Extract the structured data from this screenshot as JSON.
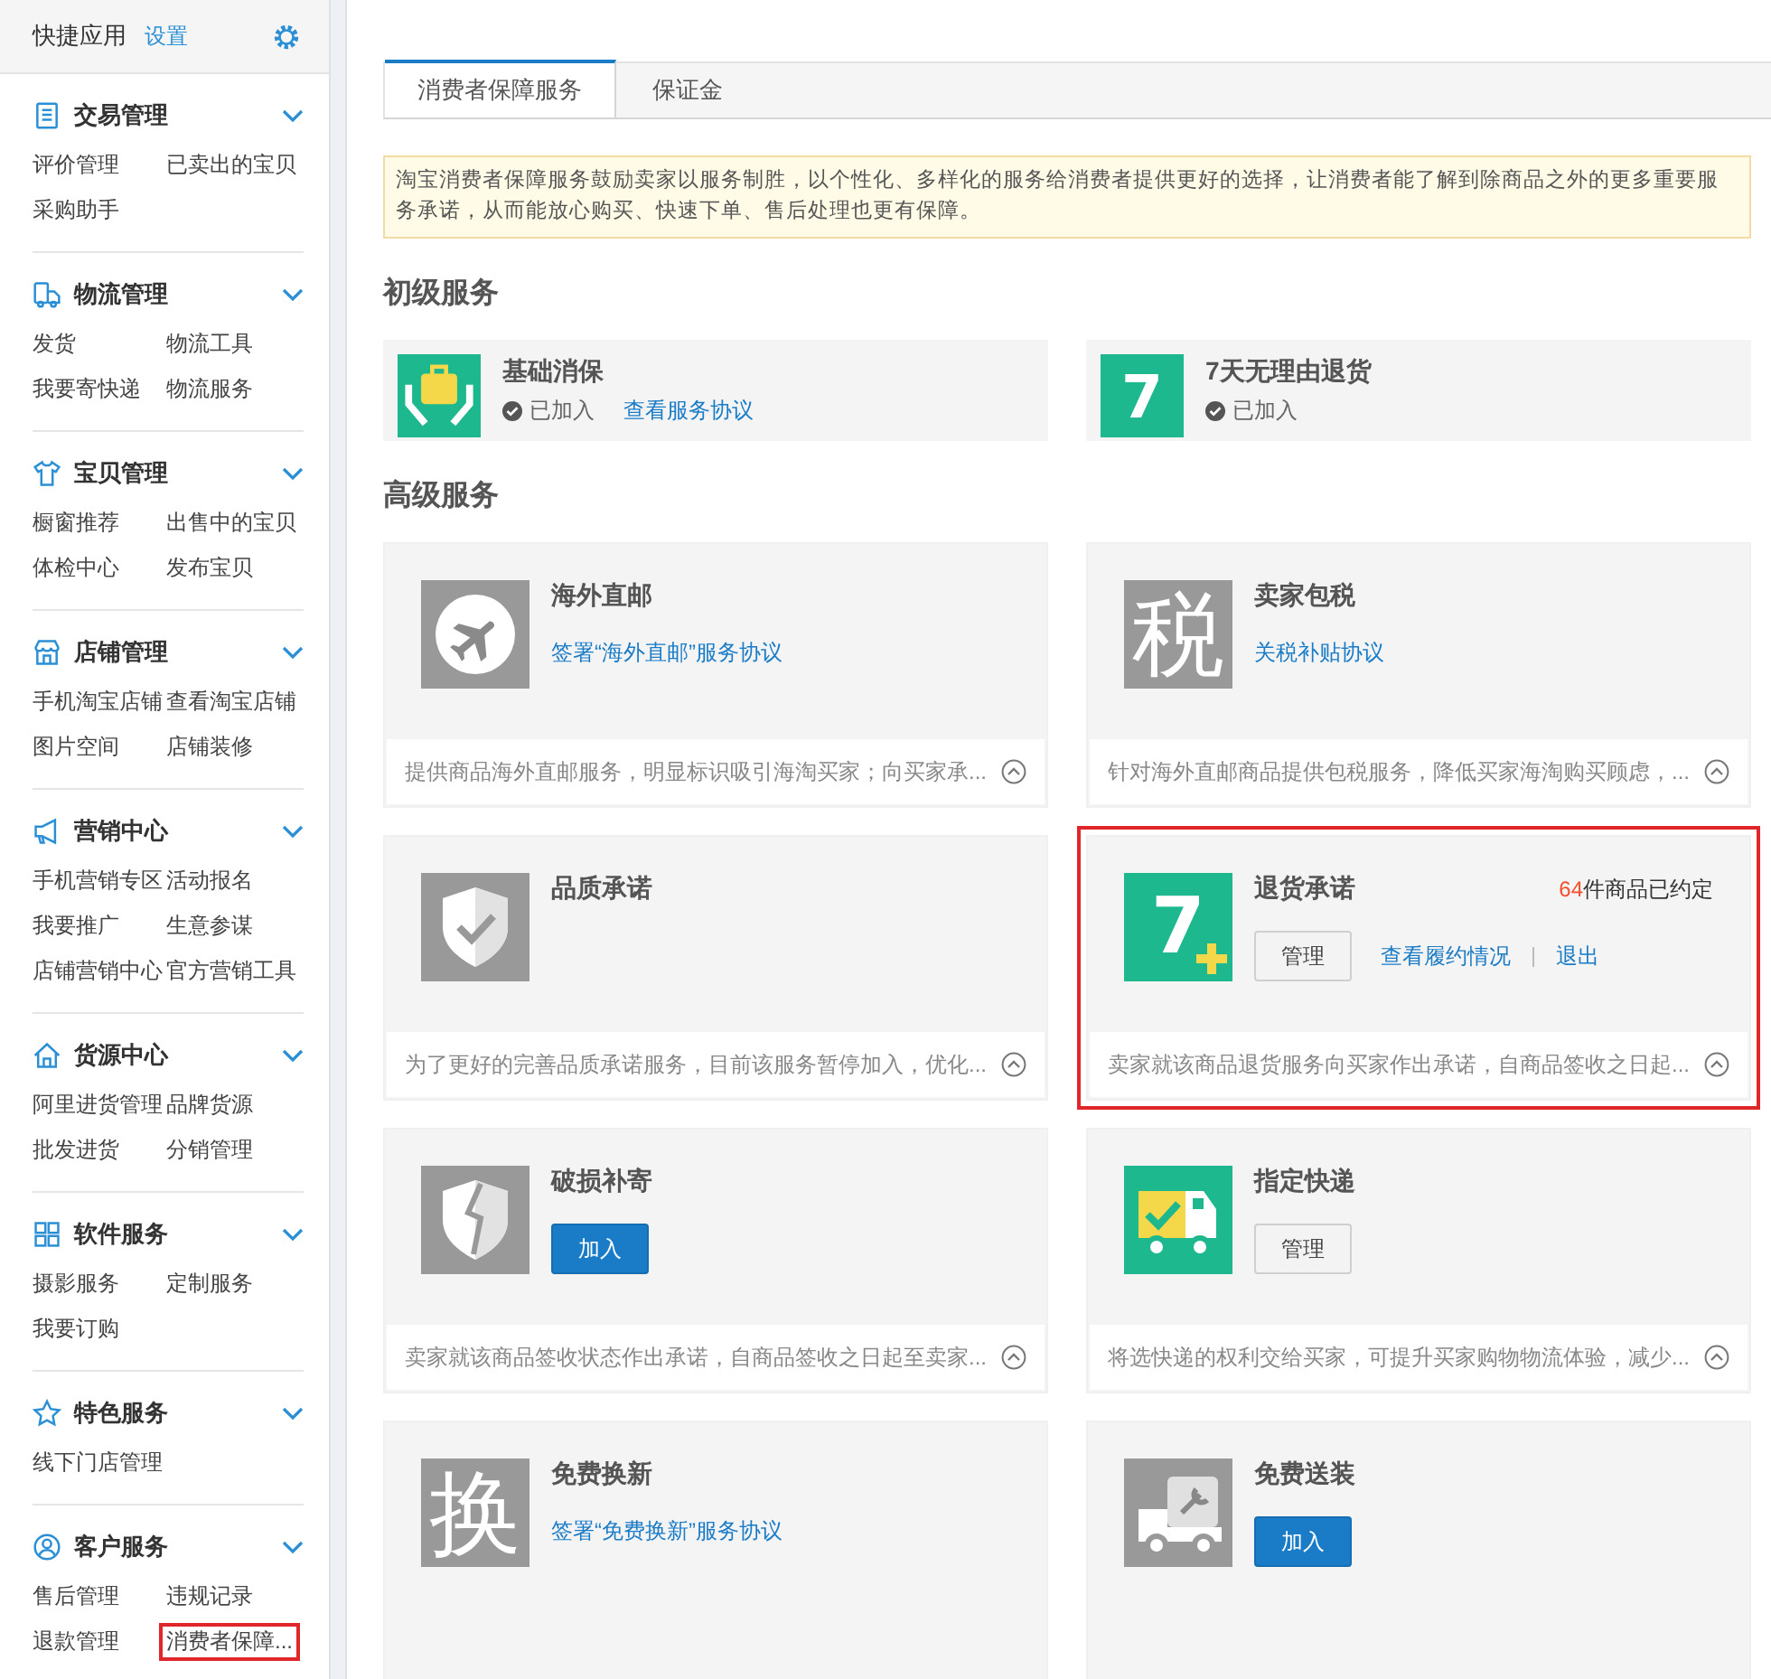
{
  "sidebar": {
    "title": "快捷应用",
    "settings_link": "设置",
    "groups": [
      {
        "kind": "list",
        "title": "交易管理",
        "expanded": true,
        "items": [
          {
            "label": "评价管理",
            "highlighted": false
          },
          {
            "label": "已卖出的宝贝",
            "highlighted": false
          },
          {
            "label": "采购助手",
            "highlighted": false
          }
        ]
      },
      {
        "kind": "truck",
        "title": "物流管理",
        "expanded": true,
        "items": [
          {
            "label": "发货",
            "highlighted": false
          },
          {
            "label": "物流工具",
            "highlighted": false
          },
          {
            "label": "我要寄快递",
            "highlighted": false
          },
          {
            "label": "物流服务",
            "highlighted": false
          }
        ]
      },
      {
        "kind": "shirt",
        "title": "宝贝管理",
        "expanded": true,
        "items": [
          {
            "label": "橱窗推荐",
            "highlighted": false
          },
          {
            "label": "出售中的宝贝",
            "highlighted": false
          },
          {
            "label": "体检中心",
            "highlighted": false
          },
          {
            "label": "发布宝贝",
            "highlighted": false
          }
        ]
      },
      {
        "kind": "shop",
        "title": "店铺管理",
        "expanded": true,
        "items": [
          {
            "label": "手机淘宝店铺",
            "highlighted": false
          },
          {
            "label": "查看淘宝店铺",
            "highlighted": false
          },
          {
            "label": "图片空间",
            "highlighted": false
          },
          {
            "label": "店铺装修",
            "highlighted": false
          }
        ]
      },
      {
        "kind": "megaphone",
        "title": "营销中心",
        "expanded": true,
        "items": [
          {
            "label": "手机营销专区",
            "highlighted": false
          },
          {
            "label": "活动报名",
            "highlighted": false
          },
          {
            "label": "我要推广",
            "highlighted": false
          },
          {
            "label": "生意参谋",
            "highlighted": false
          },
          {
            "label": "店铺营销中心",
            "highlighted": false
          },
          {
            "label": "官方营销工具",
            "highlighted": false
          }
        ]
      },
      {
        "kind": "house",
        "title": "货源中心",
        "expanded": true,
        "items": [
          {
            "label": "阿里进货管理",
            "highlighted": false
          },
          {
            "label": "品牌货源",
            "highlighted": false
          },
          {
            "label": "批发进货",
            "highlighted": false
          },
          {
            "label": "分销管理",
            "highlighted": false
          }
        ]
      },
      {
        "kind": "grid",
        "title": "软件服务",
        "expanded": true,
        "items": [
          {
            "label": "摄影服务",
            "highlighted": false
          },
          {
            "label": "定制服务",
            "highlighted": false
          },
          {
            "label": "我要订购",
            "highlighted": false
          }
        ]
      },
      {
        "kind": "star",
        "title": "特色服务",
        "expanded": true,
        "items": [
          {
            "label": "线下门店管理",
            "highlighted": false
          }
        ]
      },
      {
        "kind": "user",
        "title": "客户服务",
        "expanded": true,
        "items": [
          {
            "label": "售后管理",
            "highlighted": false
          },
          {
            "label": "违规记录",
            "highlighted": false
          },
          {
            "label": "退款管理",
            "highlighted": false
          },
          {
            "label": "消费者保障...",
            "highlighted": true
          }
        ]
      }
    ]
  },
  "tabs": [
    {
      "label": "消费者保障服务",
      "selected": true
    },
    {
      "label": "保证金",
      "selected": false
    }
  ],
  "notice": "淘宝消费者保障服务鼓励卖家以服务制胜，以个性化、多样化的服务给消费者提供更好的选择，让消费者能了解到除商品之外的更多重要服务承诺，从而能放心购买、快速下单、售后处理也更有保障。",
  "basic_services": {
    "heading": "初级服务",
    "items": [
      {
        "kind": "bag",
        "color": "#1eb88f",
        "name": "基础消保",
        "actions": [
          {
            "kind": "status",
            "label": "已加入"
          },
          {
            "kind": "link",
            "label": "查看服务协议"
          }
        ]
      },
      {
        "kind": "seven",
        "icon_text": "7",
        "color": "#1eb88f",
        "name": "7天无理由退货",
        "actions": [
          {
            "kind": "status",
            "label": "已加入"
          }
        ]
      }
    ]
  },
  "advanced_services": {
    "heading": "高级服务",
    "items": [
      {
        "kind": "plane",
        "color": "#999999",
        "name": "海外直邮",
        "highlighted": false,
        "actions": [
          {
            "kind": "link",
            "label": "签署“海外直邮”服务协议"
          }
        ],
        "description": "提供商品海外直邮服务，明显标识吸引海淘买家；向买家承..."
      },
      {
        "kind": "char",
        "icon_text": "税",
        "color": "#999999",
        "name": "卖家包税",
        "highlighted": false,
        "actions": [
          {
            "kind": "link",
            "label": "关税补贴协议"
          }
        ],
        "description": "针对海外直邮商品提供包税服务，降低买家海淘购买顾虑，..."
      },
      {
        "kind": "shield-check",
        "color": "#999999",
        "name": "品质承诺",
        "highlighted": false,
        "description": "为了更好的完善品质承诺服务，目前该服务暂停加入，优化..."
      },
      {
        "kind": "seven-plus",
        "icon_text": "7",
        "color": "#1eb88f",
        "name": "退货承诺",
        "highlighted": true,
        "count": "64",
        "count_suffix": "件商品已约定",
        "actions": [
          {
            "kind": "button",
            "label": "管理"
          },
          {
            "kind": "link",
            "label": "查看履约情况"
          },
          {
            "kind": "link",
            "label": "退出"
          }
        ],
        "description": "卖家就该商品退货服务向买家作出承诺，自商品签收之日起..."
      },
      {
        "kind": "shield-crack",
        "color": "#999999",
        "name": "破损补寄",
        "highlighted": false,
        "actions": [
          {
            "kind": "primary",
            "label": "加入"
          }
        ],
        "description": "卖家就该商品签收状态作出承诺，自商品签收之日起至卖家..."
      },
      {
        "kind": "truck-check",
        "color": "#1eb88f",
        "name": "指定快递",
        "highlighted": false,
        "actions": [
          {
            "kind": "button",
            "label": "管理"
          }
        ],
        "description": "将选快递的权利交给买家，可提升买家购物物流体验，减少..."
      },
      {
        "kind": "char",
        "icon_text": "换",
        "color": "#999999",
        "name": "免费换新",
        "highlighted": false,
        "actions": [
          {
            "kind": "link",
            "label": "签署“免费换新”服务协议"
          }
        ]
      },
      {
        "kind": "truck-wrench",
        "color": "#999999",
        "name": "免费送装",
        "highlighted": false,
        "actions": [
          {
            "kind": "primary",
            "label": "加入"
          }
        ]
      }
    ]
  }
}
